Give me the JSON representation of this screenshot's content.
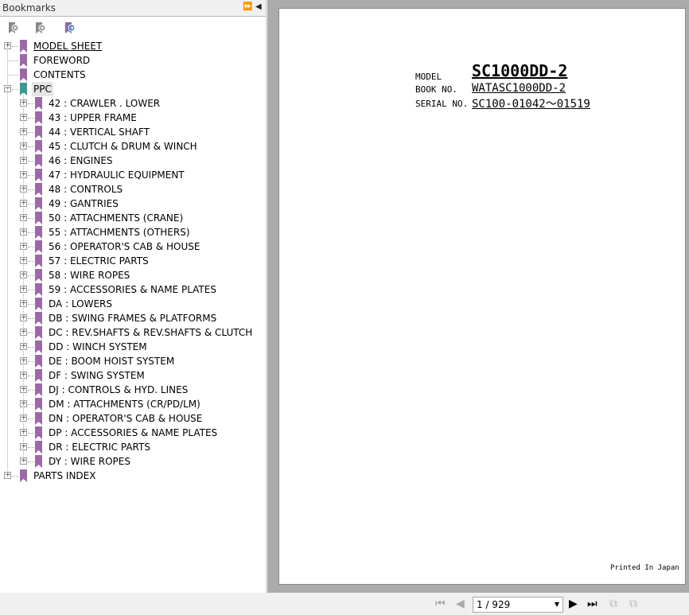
{
  "panel": {
    "title": "Bookmarks",
    "expand_icon": "double-arrow-right",
    "collapse_icon": "arrow-left"
  },
  "tools": [
    "delete-bookmark",
    "add-bookmark",
    "goto-bookmark"
  ],
  "bookmarks": [
    {
      "label": "MODEL SHEET",
      "expandable": true,
      "underline": true
    },
    {
      "label": "FOREWORD"
    },
    {
      "label": "CONTENTS"
    },
    {
      "label": "PPC",
      "expanded": true,
      "selected": true,
      "color": "#3a9a8f",
      "children": [
        "42 : CRAWLER . LOWER",
        "43 : UPPER FRAME",
        "44 : VERTICAL SHAFT",
        "45 : CLUTCH & DRUM & WINCH",
        "46 : ENGINES",
        "47 : HYDRAULIC EQUIPMENT",
        "48 : CONTROLS",
        "49 : GANTRIES",
        "50 : ATTACHMENTS (CRANE)",
        "55 : ATTACHMENTS (OTHERS)",
        "56 : OPERATOR'S CAB & HOUSE",
        "57 : ELECTRIC PARTS",
        "58 : WIRE ROPES",
        "59 : ACCESSORIES & NAME PLATES",
        "DA : LOWERS",
        "DB : SWING FRAMES & PLATFORMS",
        "DC : REV.SHAFTS & REV.SHAFTS & CLUTCH",
        "DD : WINCH SYSTEM",
        "DE : BOOM HOIST SYSTEM",
        "DF : SWING SYSTEM",
        "DJ : CONTROLS & HYD. LINES",
        "DM : ATTACHMENTS (CR/PD/LM)",
        "DN : OPERATOR'S CAB & HOUSE",
        "DP : ACCESSORIES & NAME PLATES",
        "DR : ELECTRIC PARTS",
        "DY : WIRE ROPES"
      ]
    },
    {
      "label": "PARTS INDEX",
      "expandable": true
    }
  ],
  "document": {
    "model_label": "MODEL",
    "model": "SC1000DD-2",
    "book_label": "BOOK NO.",
    "book": "WATASC1000DD-2",
    "serial_label": "SERIAL NO.",
    "serial": "SC100-01042～01519",
    "footer": "Printed In Japan"
  },
  "navigation": {
    "page": "1 / 929"
  },
  "colors": {
    "bookmark": "#9b6aa6",
    "selected_bookmark": "#3a9a8f"
  }
}
